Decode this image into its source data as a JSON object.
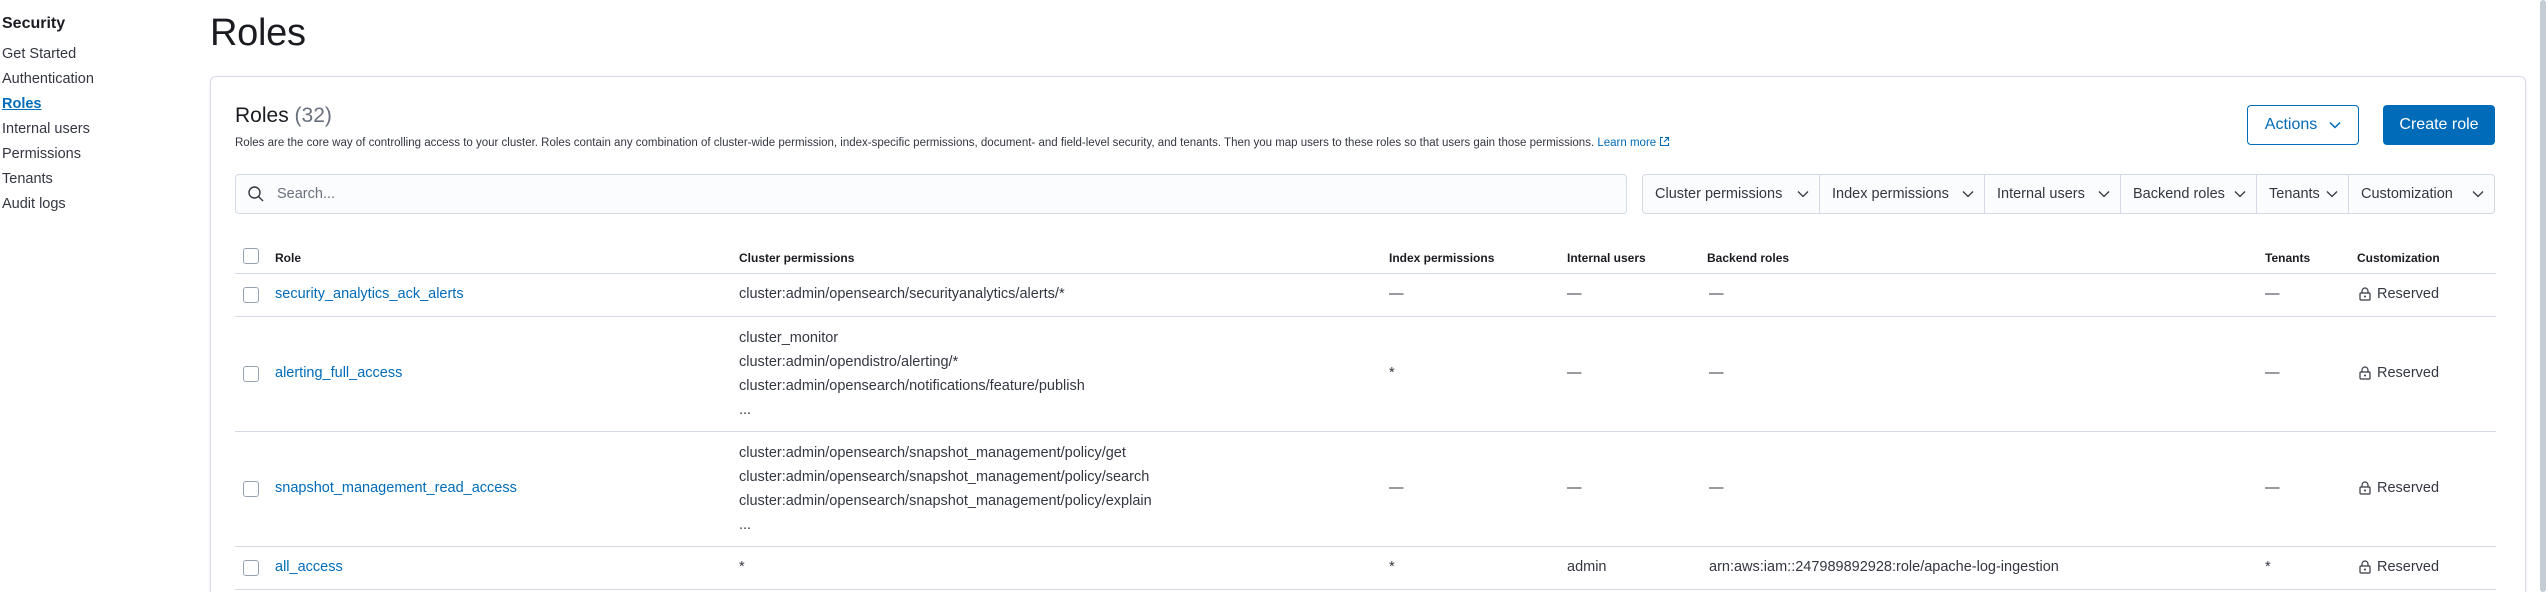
{
  "sidebar": {
    "title": "Security",
    "items": [
      {
        "label": "Get Started"
      },
      {
        "label": "Authentication"
      },
      {
        "label": "Roles",
        "active": true
      },
      {
        "label": "Internal users"
      },
      {
        "label": "Permissions"
      },
      {
        "label": "Tenants"
      },
      {
        "label": "Audit logs"
      }
    ]
  },
  "page": {
    "title": "Roles"
  },
  "panel": {
    "heading": "Roles",
    "count": "(32)",
    "description": "Roles are the core way of controlling access to your cluster. Roles contain any combination of cluster-wide permission, index-specific permissions, document- and field-level security, and tenants. Then you map users to these roles so that users gain those permissions.",
    "learn_more": "Learn more",
    "actions_label": "Actions",
    "create_label": "Create role"
  },
  "search": {
    "placeholder": "Search..."
  },
  "filters": [
    {
      "label": "Cluster permissions"
    },
    {
      "label": "Index permissions"
    },
    {
      "label": "Internal users"
    },
    {
      "label": "Backend roles"
    },
    {
      "label": "Tenants"
    },
    {
      "label": "Customization"
    }
  ],
  "table": {
    "columns": {
      "role": "Role",
      "cluster": "Cluster permissions",
      "index": "Index permissions",
      "users": "Internal users",
      "backend": "Backend roles",
      "tenants": "Tenants",
      "customization": "Customization"
    },
    "rows": [
      {
        "role": "security_analytics_ack_alerts",
        "cluster": [
          "cluster:admin/opensearch/securityanalytics/alerts/*"
        ],
        "index": "—",
        "users": "—",
        "backend": "—",
        "tenants": "—",
        "customization": "Reserved"
      },
      {
        "role": "alerting_full_access",
        "cluster": [
          "cluster_monitor",
          "cluster:admin/opendistro/alerting/*",
          "cluster:admin/opensearch/notifications/feature/publish",
          "..."
        ],
        "index": "*",
        "users": "—",
        "backend": "—",
        "tenants": "—",
        "customization": "Reserved"
      },
      {
        "role": "snapshot_management_read_access",
        "cluster": [
          "cluster:admin/opensearch/snapshot_management/policy/get",
          "cluster:admin/opensearch/snapshot_management/policy/search",
          "cluster:admin/opensearch/snapshot_management/policy/explain",
          "..."
        ],
        "index": "—",
        "users": "—",
        "backend": "—",
        "tenants": "—",
        "customization": "Reserved"
      },
      {
        "role": "all_access",
        "cluster": [
          "*"
        ],
        "index": "*",
        "users": "admin",
        "backend": "arn:aws:iam::247989892928:role/apache-log-ingestion",
        "tenants": "*",
        "customization": "Reserved"
      }
    ]
  },
  "colors": {
    "link": "#006bb8",
    "primary": "#006bb8",
    "border": "#d3dae6",
    "text": "#343741"
  }
}
